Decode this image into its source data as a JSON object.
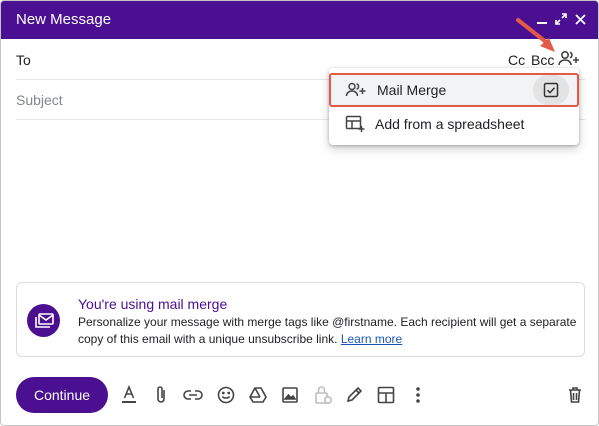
{
  "window": {
    "title": "New Message",
    "controls": [
      "minimize-icon",
      "expand-icon",
      "close-icon"
    ]
  },
  "fields": {
    "to_label": "To",
    "cc_label": "Cc",
    "bcc_label": "Bcc",
    "subject_placeholder": "Subject"
  },
  "dropdown": {
    "items": [
      {
        "label": "Mail Merge",
        "icon": "people-add-icon",
        "checked": true
      },
      {
        "label": "Add from a spreadsheet",
        "icon": "spreadsheet-add-icon"
      }
    ]
  },
  "banner": {
    "title": "You're using mail merge",
    "text": "Personalize your message with merge tags like @firstname. Each recipient will get a separate copy of this email with a unique unsubscribe link.",
    "link": "Learn more",
    "icon": "mail-merge-icon"
  },
  "toolbar": {
    "continue_label": "Continue",
    "tools": [
      "text-format-icon",
      "attach-icon",
      "link-icon",
      "emoji-icon",
      "drive-icon",
      "photo-icon",
      "confidential-lock-icon",
      "signature-pen-icon",
      "layout-template-icon",
      "more-options-icon",
      "delete-trash-icon"
    ]
  },
  "colors": {
    "brand": "#4b0f91",
    "highlight": "#e35a46",
    "link": "#1a56b8"
  }
}
